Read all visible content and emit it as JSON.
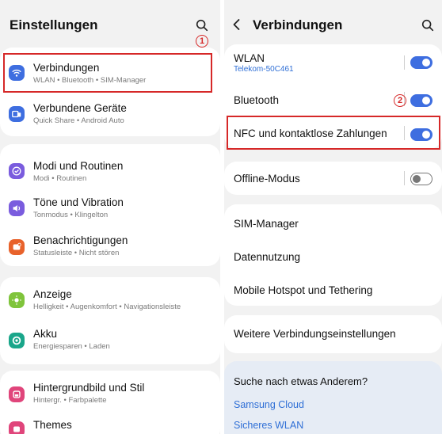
{
  "left": {
    "title": "Einstellungen",
    "annotation": "1",
    "items": [
      {
        "title": "Verbindungen",
        "subtitle": "WLAN • Bluetooth • SIM-Manager",
        "icon": "wifi-icon",
        "color": "#3e6ee0"
      },
      {
        "title": "Verbundene Geräte",
        "subtitle": "Quick Share • Android Auto",
        "icon": "devices-icon",
        "color": "#3e6ee0"
      },
      {
        "title": "Modi und Routinen",
        "subtitle": "Modi • Routinen",
        "icon": "check-circle-icon",
        "color": "#7a5cde"
      },
      {
        "title": "Töne und Vibration",
        "subtitle": "Tonmodus • Klingelton",
        "icon": "speaker-icon",
        "color": "#7a5cde"
      },
      {
        "title": "Benachrichtigungen",
        "subtitle": "Statusleiste • Nicht stören",
        "icon": "notification-icon",
        "color": "#e8622b"
      },
      {
        "title": "Anzeige",
        "subtitle": "Helligkeit • Augenkomfort • Navigationsleiste",
        "icon": "sun-icon",
        "color": "#7fc43b"
      },
      {
        "title": "Akku",
        "subtitle": "Energiesparen • Laden",
        "icon": "battery-icon",
        "color": "#1aa68a"
      },
      {
        "title": "Hintergrundbild und Stil",
        "subtitle": "Hintergr. • Farbpalette",
        "icon": "palette-icon",
        "color": "#e0457b"
      },
      {
        "title": "Themes",
        "subtitle": "",
        "icon": "themes-icon",
        "color": "#e0457b"
      }
    ]
  },
  "right": {
    "back_icon": "chevron-left-icon",
    "title": "Verbindungen",
    "annotation": "2",
    "wlan": {
      "title": "WLAN",
      "subtitle": "Telekom-50C461",
      "on": true
    },
    "bluetooth": {
      "title": "Bluetooth",
      "on": true
    },
    "nfc": {
      "title": "NFC und kontaktlose Zahlungen",
      "on": true
    },
    "offline": {
      "title": "Offline-Modus",
      "on": false
    },
    "sim_manager": "SIM-Manager",
    "data_usage": "Datennutzung",
    "hotspot": "Mobile Hotspot und Tethering",
    "more_settings": "Weitere Verbindungseinstellungen",
    "suggest_title": "Suche nach etwas Anderem?",
    "suggest_links": [
      "Samsung Cloud",
      "Sicheres WLAN"
    ]
  }
}
